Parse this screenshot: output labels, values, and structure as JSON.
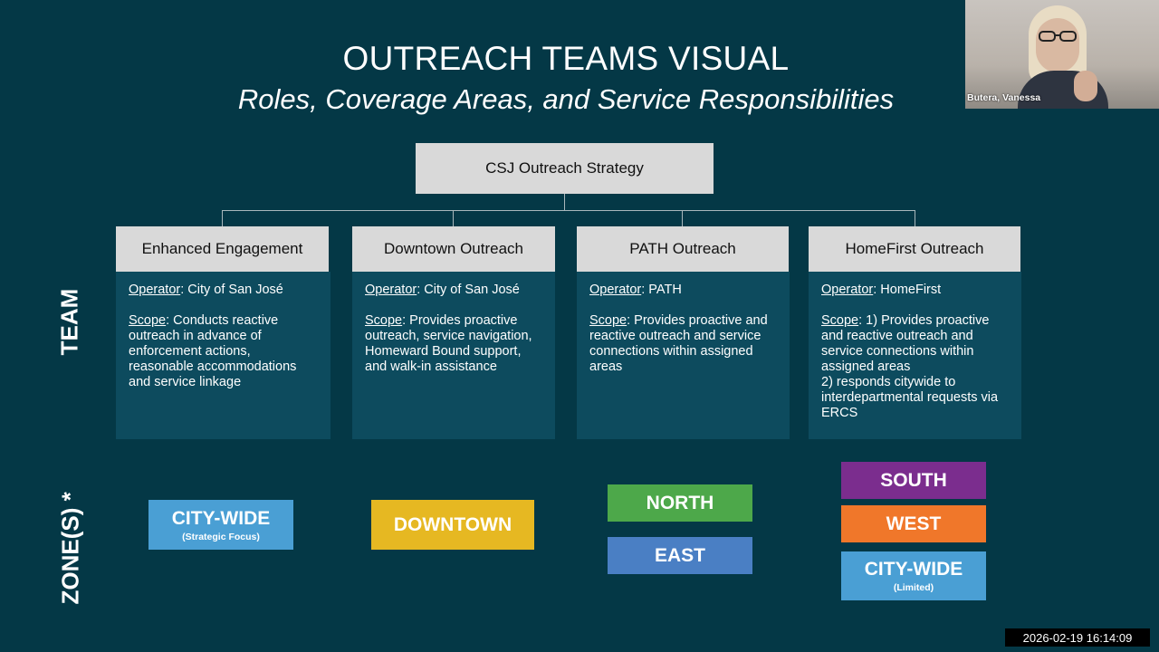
{
  "slide": {
    "title": "OUTREACH TEAMS VISUAL",
    "subtitle": "Roles, Coverage Areas, and Service Responsibilities",
    "root": "CSJ Outreach Strategy",
    "row_labels": {
      "team": "TEAM",
      "zones": "ZONE(S) *"
    },
    "teams": [
      {
        "name": "Enhanced Engagement",
        "operator_label": "Operator",
        "operator": ": City of San José",
        "scope_label": "Scope",
        "scope": ": Conducts reactive outreach in advance of enforcement actions, reasonable accommodations and service linkage"
      },
      {
        "name": "Downtown Outreach",
        "operator_label": "Operator",
        "operator": ": City of San José",
        "scope_label": "Scope",
        "scope": ": Provides proactive outreach, service navigation, Homeward Bound support, and walk-in assistance"
      },
      {
        "name": "PATH Outreach",
        "operator_label": "Operator",
        "operator": ": PATH",
        "scope_label": "Scope",
        "scope": ": Provides proactive and reactive outreach and service connections within assigned areas"
      },
      {
        "name": "HomeFirst Outreach",
        "operator_label": "Operator",
        "operator": ": HomeFirst",
        "scope_label": "Scope",
        "scope": ": 1) Provides proactive and reactive outreach and service connections within assigned areas",
        "scope_extra": "2) responds citywide to interdepartmental  requests via ERCS"
      }
    ],
    "zones": {
      "citywide_strategic": {
        "label": "CITY-WIDE",
        "sub": "(Strategic Focus)",
        "color": "#4a9fd4"
      },
      "downtown": {
        "label": "DOWNTOWN",
        "color": "#e6b822"
      },
      "north": {
        "label": "NORTH",
        "color": "#4da84a"
      },
      "east": {
        "label": "EAST",
        "color": "#4a7fc4"
      },
      "south": {
        "label": "SOUTH",
        "color": "#7b2d8e"
      },
      "west": {
        "label": "WEST",
        "color": "#f0772a"
      },
      "citywide_limited": {
        "label": "CITY-WIDE",
        "sub": "(Limited)",
        "color": "#4a9fd4"
      }
    }
  },
  "video": {
    "participant_name": "Butera, Vanessa"
  },
  "timestamp": "2026-02-19  16:14:09",
  "colors": {
    "background": "#043846",
    "card": "#0d4b5e",
    "header": "#d9d9d9"
  }
}
